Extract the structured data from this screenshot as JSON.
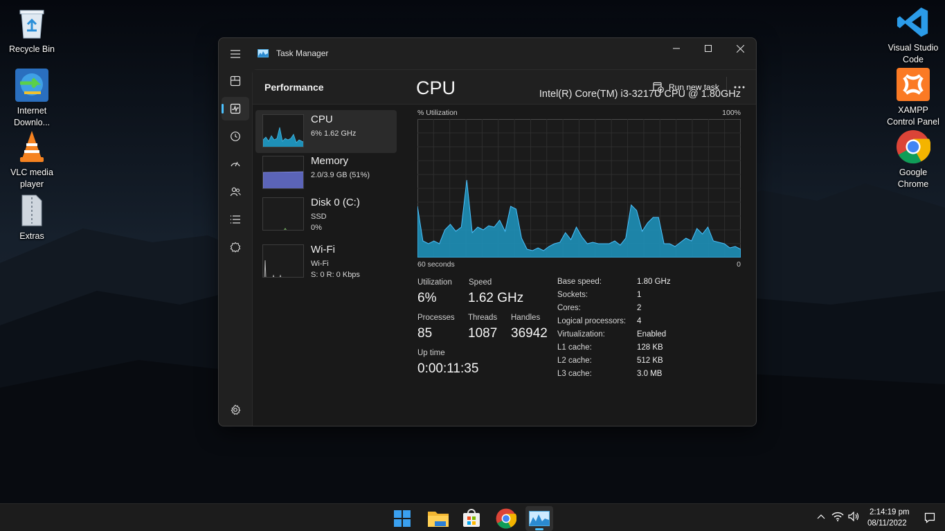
{
  "desktop": {
    "icons_left": [
      {
        "label": "Recycle Bin",
        "icon": "recycle-bin-icon"
      },
      {
        "label": "Internet\nDownlo...",
        "icon": "internet-download-manager-icon"
      },
      {
        "label": "VLC media\nplayer",
        "icon": "vlc-icon"
      },
      {
        "label": "Extras",
        "icon": "zip-folder-icon"
      }
    ],
    "icons_right": [
      {
        "label": "Visual Studio\nCode",
        "icon": "vscode-icon"
      },
      {
        "label": "XAMPP\nControl Panel",
        "icon": "xampp-icon"
      },
      {
        "label": "Google\nChrome",
        "icon": "chrome-icon"
      }
    ]
  },
  "window": {
    "title": "Task Manager",
    "controls": [
      "minimize-icon",
      "maximize-icon",
      "close-icon"
    ]
  },
  "nav": {
    "items": [
      "hamburger-icon",
      "processes-icon",
      "performance-icon",
      "app-history-icon",
      "startup-apps-icon",
      "users-icon",
      "details-icon",
      "services-icon"
    ],
    "settings": "settings-icon",
    "active": "performance"
  },
  "header": {
    "title": "Performance",
    "run_new_task": "Run new task",
    "more": "more-options-icon"
  },
  "devices": [
    {
      "name": "CPU",
      "line1": "6% 1.62 GHz",
      "line2": ""
    },
    {
      "name": "Memory",
      "line1": "2.0/3.9 GB (51%)",
      "line2": ""
    },
    {
      "name": "Disk 0 (C:)",
      "line1": "SSD",
      "line2": "0%"
    },
    {
      "name": "Wi-Fi",
      "line1": "Wi-Fi",
      "line2": "S: 0 R: 0 Kbps"
    }
  ],
  "cpu": {
    "heading": "CPU",
    "model": "Intel(R) Core(TM) i3-3217U CPU @ 1.80GHz",
    "util_label": "% Utilization",
    "util_max": "100%",
    "time_label": "60 seconds",
    "zero_label": "0",
    "stats": {
      "utilization_label": "Utilization",
      "utilization": "6%",
      "speed_label": "Speed",
      "speed": "1.62 GHz",
      "processes_label": "Processes",
      "processes": "85",
      "threads_label": "Threads",
      "threads": "1087",
      "handles_label": "Handles",
      "handles": "36942",
      "uptime_label": "Up time",
      "uptime": "0:00:11:35"
    },
    "specs": [
      {
        "key": "Base speed:",
        "value": "1.80 GHz"
      },
      {
        "key": "Sockets:",
        "value": "1"
      },
      {
        "key": "Cores:",
        "value": "2"
      },
      {
        "key": "Logical processors:",
        "value": "4"
      },
      {
        "key": "Virtualization:",
        "value": "Enabled"
      },
      {
        "key": "L1 cache:",
        "value": "128 KB"
      },
      {
        "key": "L2 cache:",
        "value": "512 KB"
      },
      {
        "key": "L3 cache:",
        "value": "3.0 MB"
      }
    ],
    "history": [
      37,
      12,
      10,
      12,
      10,
      20,
      24,
      19,
      22,
      56,
      18,
      22,
      20,
      23,
      22,
      27,
      19,
      37,
      35,
      14,
      6,
      5,
      7,
      5,
      8,
      10,
      11,
      18,
      13,
      22,
      15,
      10,
      11,
      10,
      10,
      10,
      12,
      9,
      14,
      38,
      34,
      19,
      25,
      29,
      29,
      10,
      10,
      8,
      11,
      14,
      12,
      21,
      17,
      22,
      12,
      11,
      10,
      7,
      8,
      6
    ]
  },
  "taskbar": {
    "apps": [
      "start-icon",
      "file-explorer-icon",
      "microsoft-store-icon",
      "chrome-icon",
      "task-manager-icon"
    ],
    "time": "2:14:19 pm",
    "date": "08/11/2022",
    "colors": {
      "accent": "#4cc2ff",
      "graph": "#1e90b8"
    }
  }
}
